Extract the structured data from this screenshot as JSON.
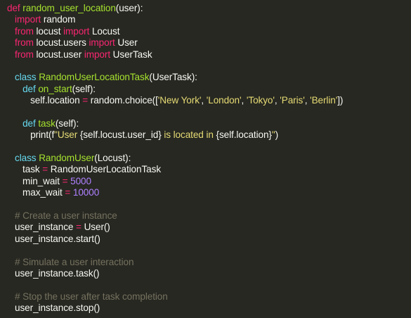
{
  "theme": {
    "background": "#272822",
    "foreground": "#f8f8f2",
    "keyword": "#f92672",
    "function": "#a6e22e",
    "string": "#e6db74",
    "number": "#ae81ff",
    "comment": "#75715e",
    "builtin": "#66d9ef"
  },
  "code_lines": [
    [
      {
        "t": "kw",
        "v": "def "
      },
      {
        "t": "fn",
        "v": "random_user_location"
      },
      {
        "t": "pl",
        "v": "(user):"
      }
    ],
    [
      {
        "t": "pl",
        "v": "   "
      },
      {
        "t": "kw",
        "v": "import"
      },
      {
        "t": "pl",
        "v": " random"
      }
    ],
    [
      {
        "t": "pl",
        "v": "   "
      },
      {
        "t": "kw",
        "v": "from"
      },
      {
        "t": "pl",
        "v": " locust "
      },
      {
        "t": "kw",
        "v": "import"
      },
      {
        "t": "pl",
        "v": " Locust"
      }
    ],
    [
      {
        "t": "pl",
        "v": "   "
      },
      {
        "t": "kw",
        "v": "from"
      },
      {
        "t": "pl",
        "v": " locust.users "
      },
      {
        "t": "kw",
        "v": "import"
      },
      {
        "t": "pl",
        "v": " User"
      }
    ],
    [
      {
        "t": "pl",
        "v": "   "
      },
      {
        "t": "kw",
        "v": "from"
      },
      {
        "t": "pl",
        "v": " locust.user "
      },
      {
        "t": "kw",
        "v": "import"
      },
      {
        "t": "pl",
        "v": " UserTask"
      }
    ],
    [],
    [
      {
        "t": "pl",
        "v": "   "
      },
      {
        "t": "bi",
        "v": "class "
      },
      {
        "t": "cls",
        "v": "RandomUserLocationTask"
      },
      {
        "t": "pl",
        "v": "(UserTask):"
      }
    ],
    [
      {
        "t": "pl",
        "v": "      "
      },
      {
        "t": "bi",
        "v": "def "
      },
      {
        "t": "fn",
        "v": "on_start"
      },
      {
        "t": "pl",
        "v": "(self):"
      }
    ],
    [
      {
        "t": "pl",
        "v": "         self.location "
      },
      {
        "t": "op",
        "v": "="
      },
      {
        "t": "pl",
        "v": " random.choice(["
      },
      {
        "t": "str",
        "v": "'New York'"
      },
      {
        "t": "pl",
        "v": ", "
      },
      {
        "t": "str",
        "v": "'London'"
      },
      {
        "t": "pl",
        "v": ", "
      },
      {
        "t": "str",
        "v": "'Tokyo'"
      },
      {
        "t": "pl",
        "v": ", "
      },
      {
        "t": "str",
        "v": "'Paris'"
      },
      {
        "t": "pl",
        "v": ", "
      },
      {
        "t": "str",
        "v": "'Berlin'"
      },
      {
        "t": "pl",
        "v": "])"
      }
    ],
    [],
    [
      {
        "t": "pl",
        "v": "      "
      },
      {
        "t": "bi",
        "v": "def "
      },
      {
        "t": "fn",
        "v": "task"
      },
      {
        "t": "pl",
        "v": "(self):"
      }
    ],
    [
      {
        "t": "pl",
        "v": "         print(f"
      },
      {
        "t": "str",
        "v": "\"User "
      },
      {
        "t": "pl",
        "v": "{self.locust.user_id}"
      },
      {
        "t": "str",
        "v": " is located in "
      },
      {
        "t": "pl",
        "v": "{self.location}"
      },
      {
        "t": "str",
        "v": "\""
      },
      {
        "t": "pl",
        "v": ")"
      }
    ],
    [],
    [
      {
        "t": "pl",
        "v": "   "
      },
      {
        "t": "bi",
        "v": "class "
      },
      {
        "t": "cls",
        "v": "RandomUser"
      },
      {
        "t": "pl",
        "v": "(Locust):"
      }
    ],
    [
      {
        "t": "pl",
        "v": "      task "
      },
      {
        "t": "op",
        "v": "="
      },
      {
        "t": "pl",
        "v": " RandomUserLocationTask"
      }
    ],
    [
      {
        "t": "pl",
        "v": "      min_wait "
      },
      {
        "t": "op",
        "v": "="
      },
      {
        "t": "pl",
        "v": " "
      },
      {
        "t": "num",
        "v": "5000"
      }
    ],
    [
      {
        "t": "pl",
        "v": "      max_wait "
      },
      {
        "t": "op",
        "v": "="
      },
      {
        "t": "pl",
        "v": " "
      },
      {
        "t": "num",
        "v": "10000"
      }
    ],
    [],
    [
      {
        "t": "pl",
        "v": "   "
      },
      {
        "t": "cm",
        "v": "# Create a user instance"
      }
    ],
    [
      {
        "t": "pl",
        "v": "   user_instance "
      },
      {
        "t": "op",
        "v": "="
      },
      {
        "t": "pl",
        "v": " User()"
      }
    ],
    [
      {
        "t": "pl",
        "v": "   user_instance.start()"
      }
    ],
    [],
    [
      {
        "t": "pl",
        "v": "   "
      },
      {
        "t": "cm",
        "v": "# Simulate a user interaction"
      }
    ],
    [
      {
        "t": "pl",
        "v": "   user_instance.task()"
      }
    ],
    [],
    [
      {
        "t": "pl",
        "v": "   "
      },
      {
        "t": "cm",
        "v": "# Stop the user after task completion"
      }
    ],
    [
      {
        "t": "pl",
        "v": "   user_instance.stop()"
      }
    ]
  ]
}
